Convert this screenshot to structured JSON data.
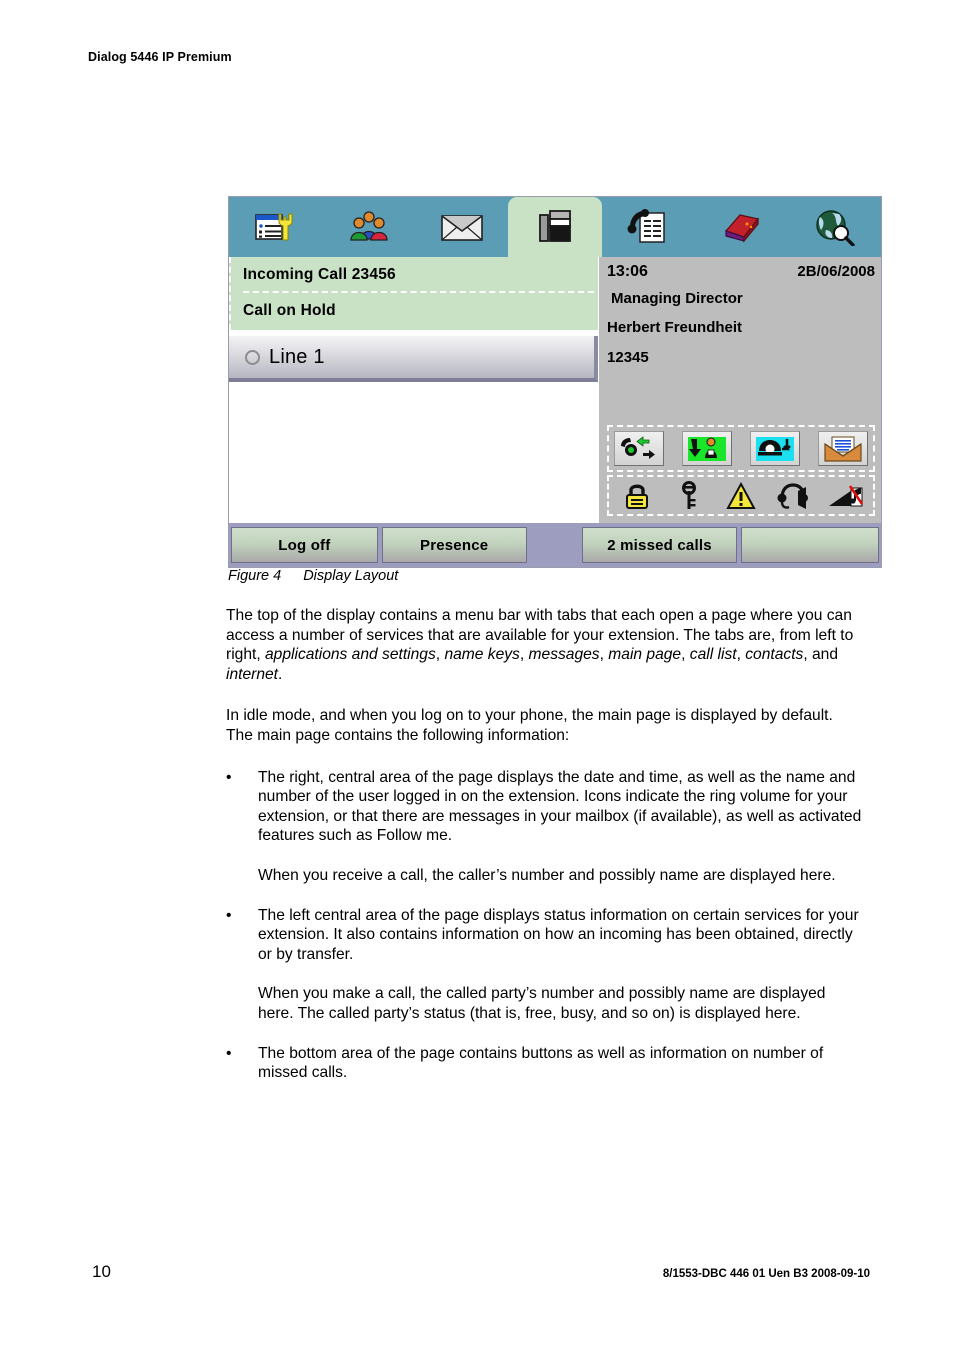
{
  "document": {
    "running_head": "Dialog 5446 IP Premium",
    "page_number": "10",
    "doc_id": "8/1553-DBC 446 01 Uen B3  2008-09-10"
  },
  "figure": {
    "caption_number": "Figure 4",
    "caption_title": "Display Layout",
    "colors": {
      "tabbar": "#5b9db5",
      "selected_tab": "#c9e2c6",
      "status_panel": "#c9e2c6",
      "right_panel": "#bdbdbd",
      "button_bar": "#9d9dc0",
      "soft_button": "#c2d3be"
    },
    "tabs": [
      {
        "name": "applications-and-settings",
        "icon": "settings-list-wrench-icon",
        "selected": false
      },
      {
        "name": "name-keys",
        "icon": "three-people-icon",
        "selected": false
      },
      {
        "name": "messages",
        "icon": "envelope-icon",
        "selected": false
      },
      {
        "name": "main-page",
        "icon": "desk-phone-icon",
        "selected": true
      },
      {
        "name": "call-list",
        "icon": "handset-list-icon",
        "selected": false
      },
      {
        "name": "contacts",
        "icon": "red-book-icon",
        "selected": false
      },
      {
        "name": "internet",
        "icon": "globe-magnifier-icon",
        "selected": false
      }
    ],
    "left_panel": {
      "status_line_1": "Incoming Call 23456",
      "status_line_2": "Call on Hold",
      "line_button_label": "Line 1"
    },
    "right_panel": {
      "time": "13:06",
      "date": "2B/06/2008",
      "title": "Managing Director",
      "user_name": "Herbert Freundheit",
      "extension": "12345",
      "feature_icons_row1": [
        "call-diversion-icon",
        "follow-me-icon",
        "callback-phone-icon",
        "mailbox-message-icon"
      ],
      "feature_icons_row2": [
        "padlock-icon",
        "key-icon",
        "warning-triangle-icon",
        "headset-icon",
        "ring-volume-muted-icon"
      ]
    },
    "bottom_buttons": [
      {
        "label": "Log  off"
      },
      {
        "label": "Presence"
      },
      {
        "label": "2 missed calls"
      },
      {
        "label": ""
      }
    ]
  },
  "body": {
    "para_1_a": "The top of the display contains a menu bar with tabs that each open a page where you can access a number of services that are available for your extension. The tabs are, from left to right, ",
    "para_1_tabs": {
      "t1": "applications and settings",
      "t2": "name keys",
      "t3": "messages",
      "t4": "main page",
      "t5": "call list",
      "t6": "contacts",
      "t7": "internet"
    },
    "para_2": "In idle mode, and when you log on to your phone, the main page is displayed by default.  The main page contains the following information:",
    "bullet_marker": "•",
    "bullet_1": "The right, central area of the page displays the date and time, as well as the name and number of the user logged in on the extension.  Icons indicate the ring volume for your extension, or that there are messages in your mailbox (if available), as well as activated features such as Follow me.",
    "bullet_1_sub": "When you receive a call, the caller’s number and possibly name are displayed here.",
    "bullet_2": "The left central area of the page displays status information on certain services for your extension.  It also contains information on how an incoming has been obtained, directly or by transfer.",
    "bullet_2_sub": "When you make a call, the called party’s number and possibly name are displayed here.  The called party’s status (that is, free, busy, and so on) is displayed here.",
    "bullet_3": "The bottom area of the page contains buttons as well as information on number of missed calls."
  }
}
